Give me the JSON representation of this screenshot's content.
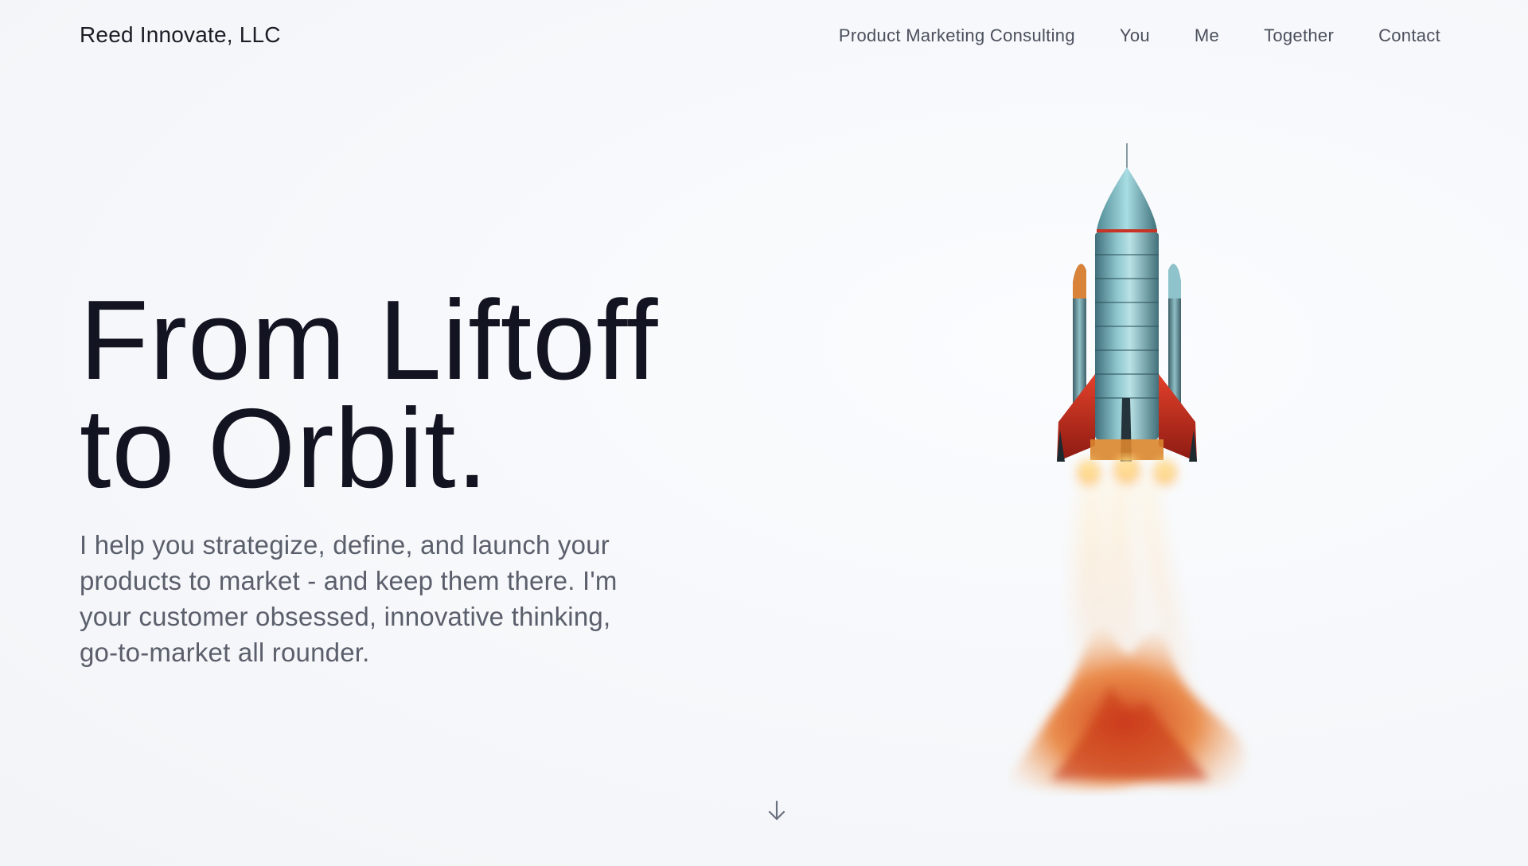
{
  "header": {
    "brand": "Reed Innovate, LLC",
    "nav": [
      {
        "label": "Product Marketing Consulting"
      },
      {
        "label": "You"
      },
      {
        "label": "Me"
      },
      {
        "label": "Together"
      },
      {
        "label": "Contact"
      }
    ]
  },
  "hero": {
    "title_line1": "From Liftoff",
    "title_line2": "to Orbit.",
    "description": "I help you strategize, define, and launch your products to market - and keep them there. I'm your customer obsessed, innovative thinking, go-to-market all rounder."
  },
  "icons": {
    "scroll": "arrow-down-icon",
    "hero_image": "rocket-illustration"
  },
  "colors": {
    "background": "#f6f8fb",
    "text_dark": "#121521",
    "text_muted": "#5a5f6b"
  }
}
